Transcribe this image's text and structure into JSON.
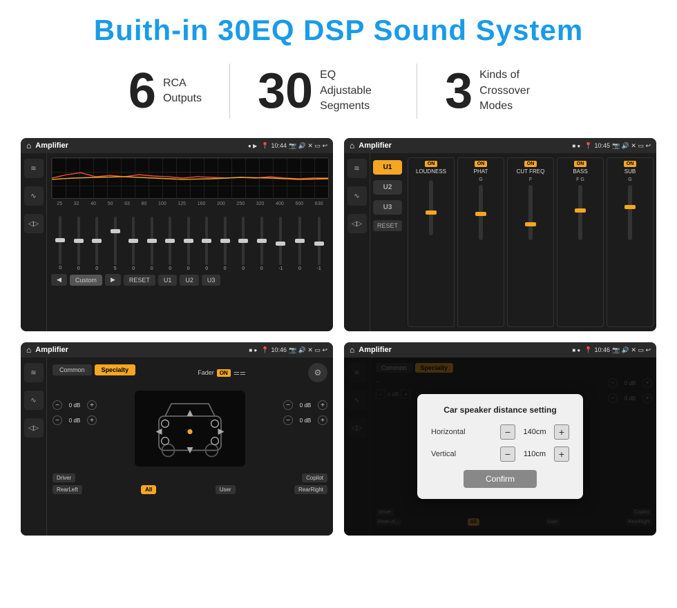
{
  "header": {
    "title": "Buith-in 30EQ DSP Sound System"
  },
  "features": [
    {
      "number": "6",
      "desc_line1": "RCA",
      "desc_line2": "Outputs"
    },
    {
      "number": "30",
      "desc_line1": "EQ Adjustable",
      "desc_line2": "Segments"
    },
    {
      "number": "3",
      "desc_line1": "Kinds of",
      "desc_line2": "Crossover Modes"
    }
  ],
  "screens": [
    {
      "id": "screen1",
      "status_app": "Amplifier",
      "status_time": "10:44",
      "eq_frequencies": [
        "25",
        "32",
        "40",
        "50",
        "63",
        "80",
        "100",
        "125",
        "160",
        "200",
        "250",
        "320",
        "400",
        "500",
        "630"
      ],
      "eq_values": [
        "0",
        "0",
        "0",
        "5",
        "0",
        "0",
        "0",
        "0",
        "0",
        "0",
        "0",
        "0",
        "-1",
        "0",
        "-1"
      ],
      "preset_label": "Custom",
      "buttons": [
        "RESET",
        "U1",
        "U2",
        "U3"
      ]
    },
    {
      "id": "screen2",
      "status_app": "Amplifier",
      "status_time": "10:45",
      "u_buttons": [
        "U1",
        "U2",
        "U3"
      ],
      "sections": [
        {
          "label": "LOUDNESS",
          "on": true
        },
        {
          "label": "PHAT",
          "on": true
        },
        {
          "label": "CUT FREQ",
          "on": true
        },
        {
          "label": "BASS",
          "on": true
        },
        {
          "label": "SUB",
          "on": true
        }
      ]
    },
    {
      "id": "screen3",
      "status_app": "Amplifier",
      "status_time": "10:46",
      "tabs": [
        "Common",
        "Specialty"
      ],
      "fader_label": "Fader",
      "fader_on": "ON",
      "vol_controls": [
        {
          "label": "0 dB"
        },
        {
          "label": "0 dB"
        },
        {
          "label": "0 dB"
        },
        {
          "label": "0 dB"
        }
      ],
      "bottom_labels": [
        "Driver",
        "",
        "Copilot",
        "RearLeft",
        "All",
        "",
        "User",
        "RearRight"
      ]
    },
    {
      "id": "screen4",
      "status_app": "Amplifier",
      "status_time": "10:46",
      "dialog": {
        "title": "Car speaker distance setting",
        "fields": [
          {
            "label": "Horizontal",
            "value": "140cm"
          },
          {
            "label": "Vertical",
            "value": "110cm"
          }
        ],
        "confirm_label": "Confirm"
      }
    }
  ]
}
